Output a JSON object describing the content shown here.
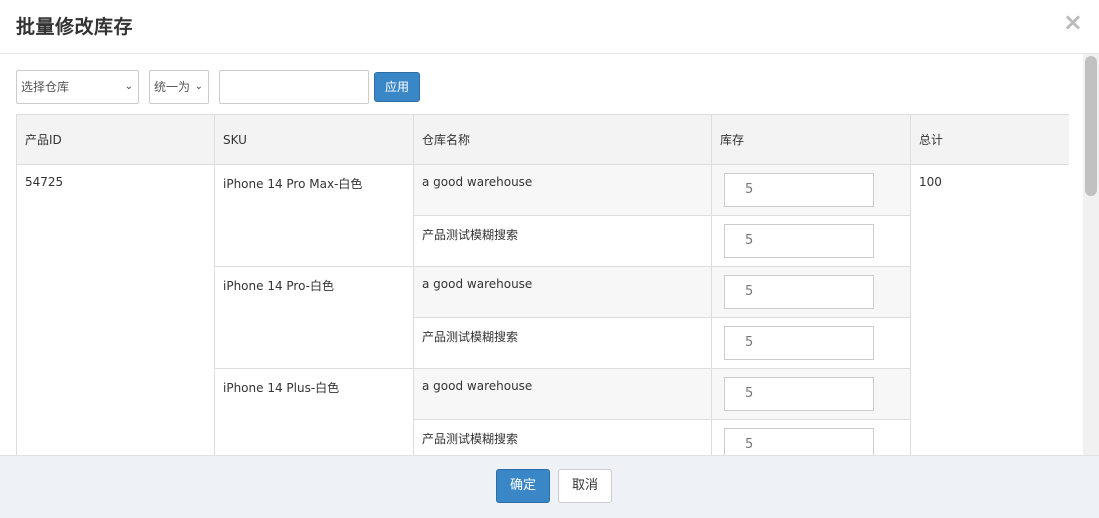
{
  "modal": {
    "title": "批量修改库存",
    "close_icon": "×"
  },
  "toolbar": {
    "warehouse_select": "选择仓库",
    "mode_select": "统一为",
    "value_input": "",
    "apply_label": "应用"
  },
  "table": {
    "headers": [
      "产品ID",
      "SKU",
      "仓库名称",
      "库存",
      "总计"
    ],
    "product_id": "54725",
    "total": "100",
    "skus": [
      {
        "name": "iPhone 14 Pro Max-白色",
        "rows": [
          {
            "warehouse": "a good warehouse",
            "stock": "5"
          },
          {
            "warehouse": "产品测试模糊搜索",
            "stock": "5"
          }
        ]
      },
      {
        "name": "iPhone 14 Pro-白色",
        "rows": [
          {
            "warehouse": "a good warehouse",
            "stock": "5"
          },
          {
            "warehouse": "产品测试模糊搜索",
            "stock": "5"
          }
        ]
      },
      {
        "name": "iPhone 14 Plus-白色",
        "rows": [
          {
            "warehouse": "a good warehouse",
            "stock": "5"
          },
          {
            "warehouse": "产品测试模糊搜索",
            "stock": "5"
          }
        ]
      }
    ]
  },
  "footer": {
    "ok_label": "确定",
    "cancel_label": "取消"
  }
}
